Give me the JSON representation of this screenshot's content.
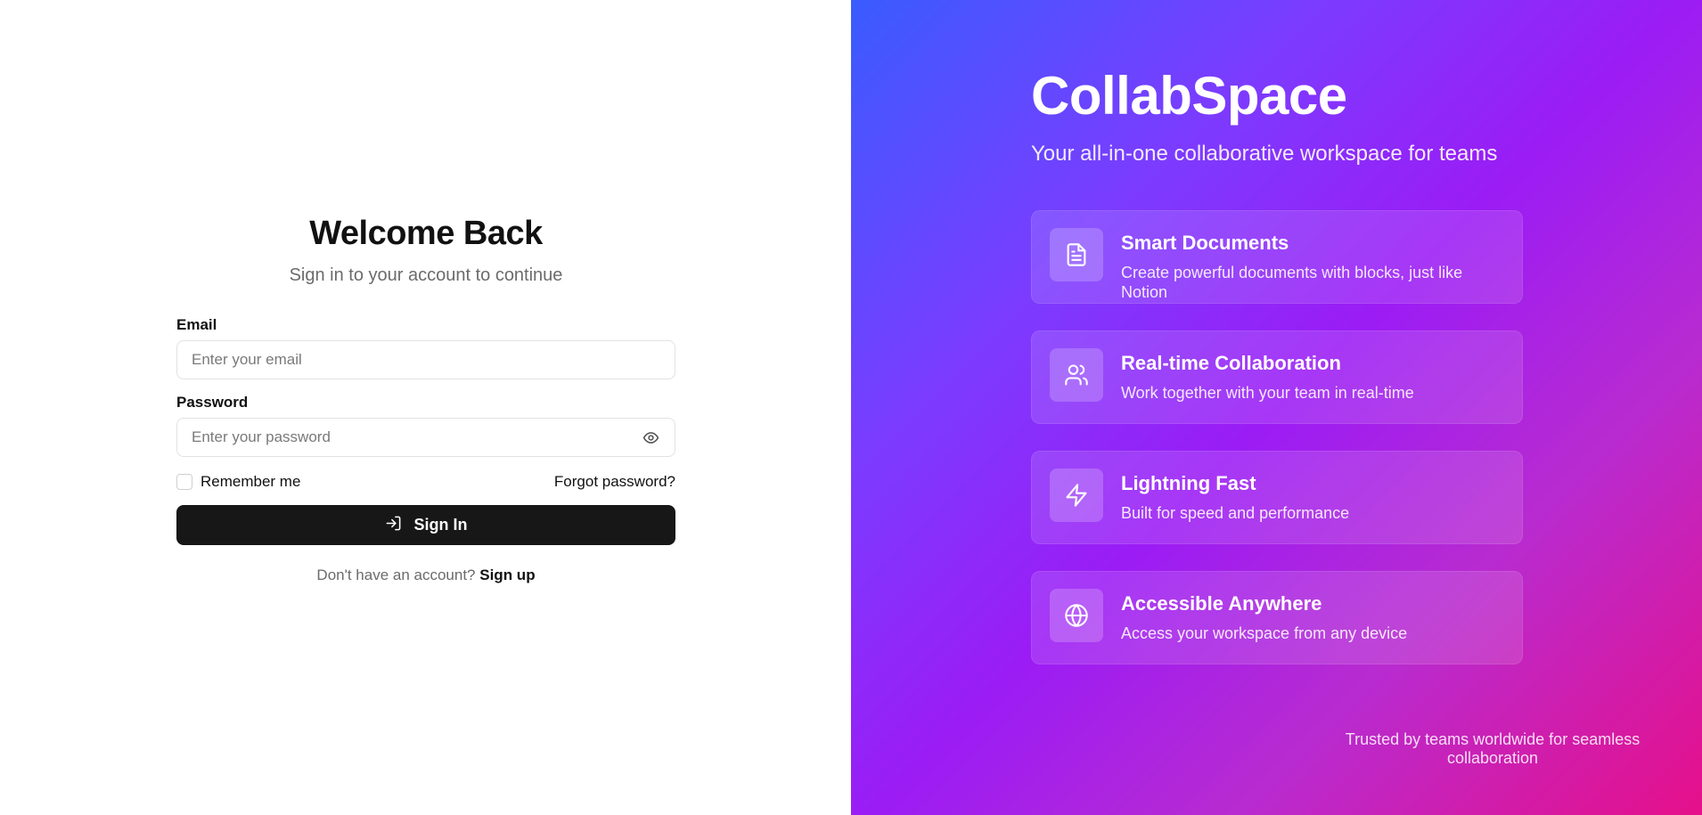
{
  "login": {
    "title": "Welcome Back",
    "subtitle": "Sign in to your account to continue",
    "email_label": "Email",
    "email_placeholder": "Enter your email",
    "password_label": "Password",
    "password_placeholder": "Enter your password",
    "remember_label": "Remember me",
    "forgot_label": "Forgot password?",
    "signin_label": "Sign In",
    "no_account_text": "Don't have an account?",
    "signup_label": "Sign up"
  },
  "brand_panel": {
    "brand_name": "CollabSpace",
    "tagline": "Your all-in-one collaborative workspace for teams",
    "features": [
      {
        "icon": "document-icon",
        "title": "Smart Documents",
        "description": "Create powerful documents with blocks, just like Notion"
      },
      {
        "icon": "users-icon",
        "title": "Real-time Collaboration",
        "description": "Work together with your team in real-time"
      },
      {
        "icon": "lightning-icon",
        "title": "Lightning Fast",
        "description": "Built for speed and performance"
      },
      {
        "icon": "globe-icon",
        "title": "Accessible Anywhere",
        "description": "Access your workspace from any device"
      }
    ],
    "footer": "Trusted by teams worldwide for seamless collaboration"
  },
  "colors": {
    "primary_button": "#171717",
    "gradient_start": "#3a5cff",
    "gradient_mid": "#9b1cf5",
    "gradient_end": "#e6108a"
  }
}
